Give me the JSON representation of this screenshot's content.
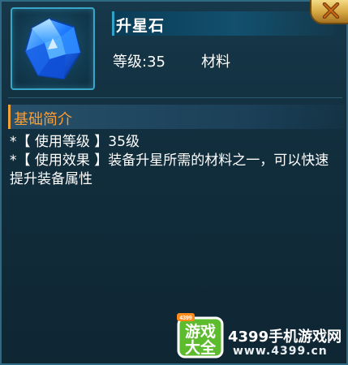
{
  "item": {
    "name": "升星石",
    "level": "等级:35",
    "category": "材料",
    "icon": "blue-gem-icon"
  },
  "close": {
    "icon": "close-x-icon"
  },
  "section": {
    "title": "基础简介"
  },
  "description": {
    "line1": "*【 使用等级 】35级",
    "line2": "*【 使用效果 】装备升星所需的材料之一，可以快速提升装备属性"
  },
  "watermark": {
    "badge_top": "游戏",
    "badge_bottom": "大全",
    "badge_tag": "4399",
    "site_name": "4399手机游戏网",
    "site_url": "www.4399.cn"
  },
  "colors": {
    "accent_orange": "#ff9d33",
    "panel_border": "#2f6a85",
    "gem_blue": "#2b8dff"
  }
}
